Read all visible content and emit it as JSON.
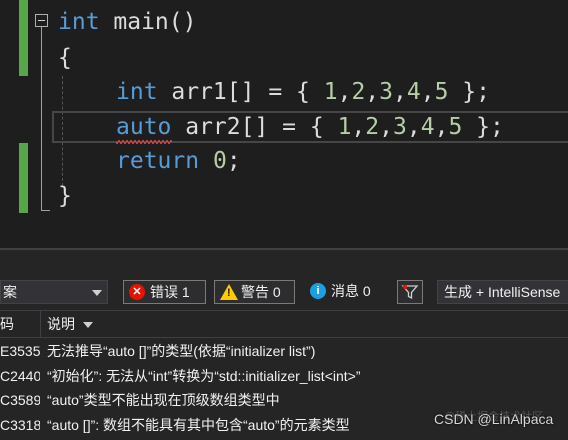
{
  "editor": {
    "lines": [
      {
        "parts": [
          {
            "k": "kw",
            "t": "int"
          },
          {
            "k": "txt",
            "t": " main()"
          }
        ]
      },
      {
        "parts": [
          {
            "k": "txt",
            "t": "{"
          }
        ]
      },
      {
        "parts": [
          {
            "k": "kw",
            "t": "int"
          },
          {
            "k": "txt",
            "t": " arr1[] = { "
          },
          {
            "k": "num",
            "t": "1"
          },
          {
            "k": "txt",
            "t": ","
          },
          {
            "k": "num",
            "t": "2"
          },
          {
            "k": "txt",
            "t": ","
          },
          {
            "k": "num",
            "t": "3"
          },
          {
            "k": "txt",
            "t": ","
          },
          {
            "k": "num",
            "t": "4"
          },
          {
            "k": "txt",
            "t": ","
          },
          {
            "k": "num",
            "t": "5"
          },
          {
            "k": "txt",
            "t": " };"
          }
        ]
      },
      {
        "parts": [
          {
            "k": "kw",
            "t": "auto"
          },
          {
            "k": "txt",
            "t": " arr2[] = { "
          },
          {
            "k": "num",
            "t": "1"
          },
          {
            "k": "txt",
            "t": ","
          },
          {
            "k": "num",
            "t": "2"
          },
          {
            "k": "txt",
            "t": ","
          },
          {
            "k": "num",
            "t": "3"
          },
          {
            "k": "txt",
            "t": ","
          },
          {
            "k": "num",
            "t": "4"
          },
          {
            "k": "txt",
            "t": ","
          },
          {
            "k": "num",
            "t": "5"
          },
          {
            "k": "txt",
            "t": " };"
          }
        ]
      },
      {
        "parts": [
          {
            "k": "kw",
            "t": "return"
          },
          {
            "k": "txt",
            "t": " "
          },
          {
            "k": "num",
            "t": "0"
          },
          {
            "k": "txt",
            "t": ";"
          }
        ]
      },
      {
        "parts": [
          {
            "k": "txt",
            "t": "}"
          }
        ]
      }
    ]
  },
  "error_list": {
    "scope_label": "案",
    "errors_label": "错误",
    "errors_count": "1",
    "warnings_label": "警告",
    "warnings_count": "0",
    "messages_label": "消息",
    "messages_count": "0",
    "source_label": "生成 + IntelliSense",
    "columns": {
      "code": "码",
      "description": "说明"
    },
    "rows": [
      {
        "code": "E3535",
        "description": "无法推导“auto []”的类型(依据“initializer list”)"
      },
      {
        "code": "C2440",
        "description": "“初始化”: 无法从“int”转换为“std::initializer_list<int>”"
      },
      {
        "code": "C3589",
        "description": "“auto”类型不能出现在顶级数组类型中"
      },
      {
        "code": "C3318",
        "description": "“auto []”: 数组不能具有其中包含“auto”的元素类型"
      }
    ]
  },
  "watermark": "CSDN @LinAlpaca",
  "watermark_faint": "@稀土掘金技术社区",
  "colors": {
    "keyword": "#569cd6",
    "number": "#b5cea8",
    "change_bar": "#57a64a",
    "error_squiggle": "#f14c4c"
  }
}
